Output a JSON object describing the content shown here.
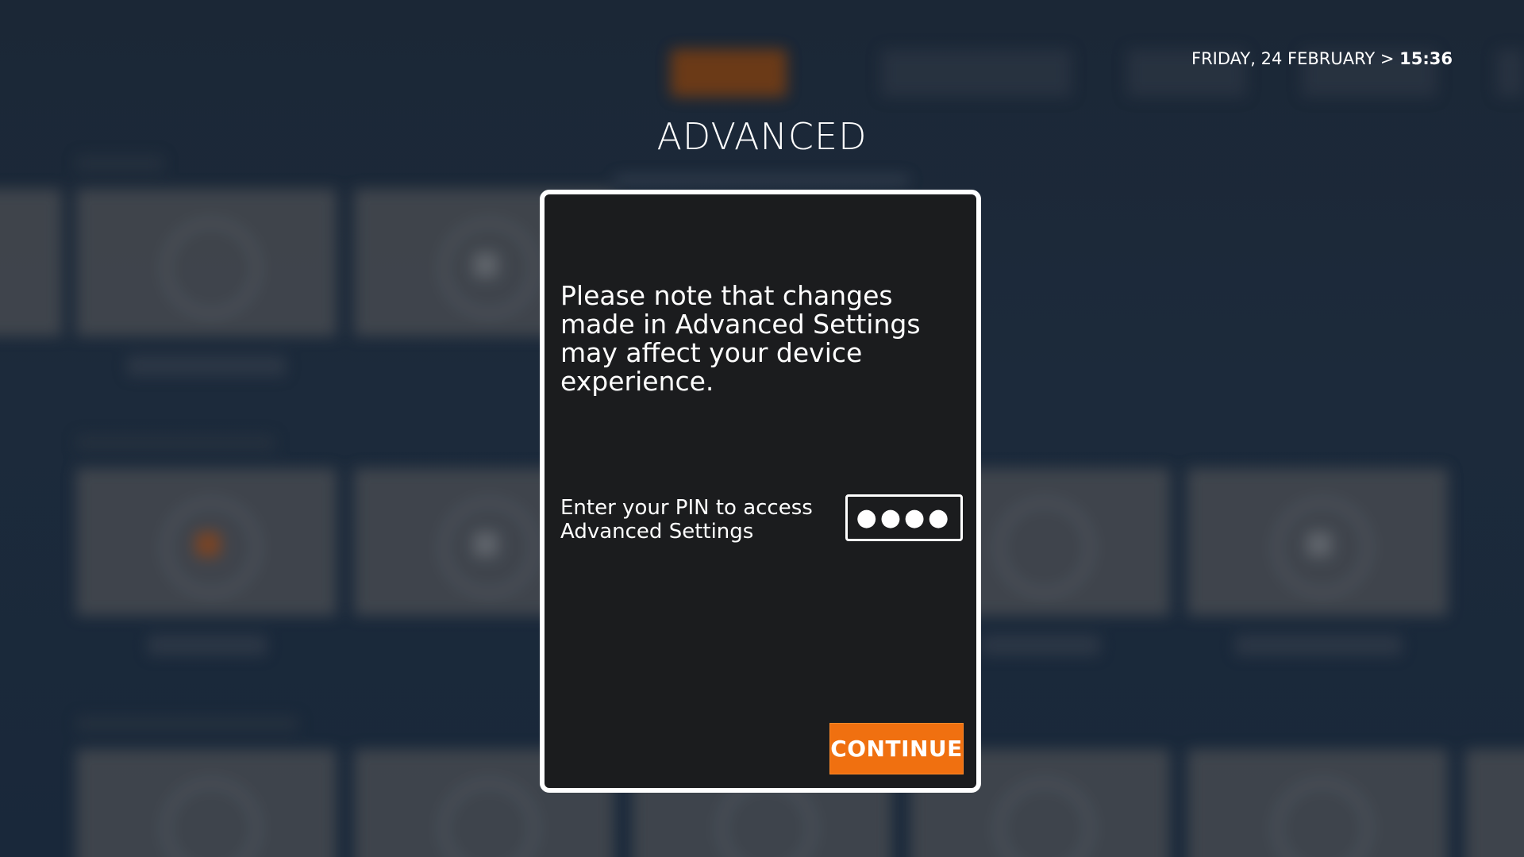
{
  "header": {
    "date": "FRIDAY, 24 FEBRUARY",
    "separator": ">",
    "time": "15:36",
    "page_title": "ADVANCED"
  },
  "modal": {
    "message": "Please note that changes made in Advanced Settings may affect your device experience.",
    "pin_label": "Enter your PIN to access Advanced Settings",
    "pin_value": "●●●●",
    "continue_label": "CONTINUE"
  },
  "colors": {
    "accent": "#f07010",
    "modal_background": "#1b1c1e",
    "page_background": "#1a2533"
  },
  "icons": [
    "settings-ring-icon",
    "dial-icon",
    "record-icon",
    "camera-icon",
    "accessibility-icon",
    "tv-icon",
    "info-icon"
  ]
}
